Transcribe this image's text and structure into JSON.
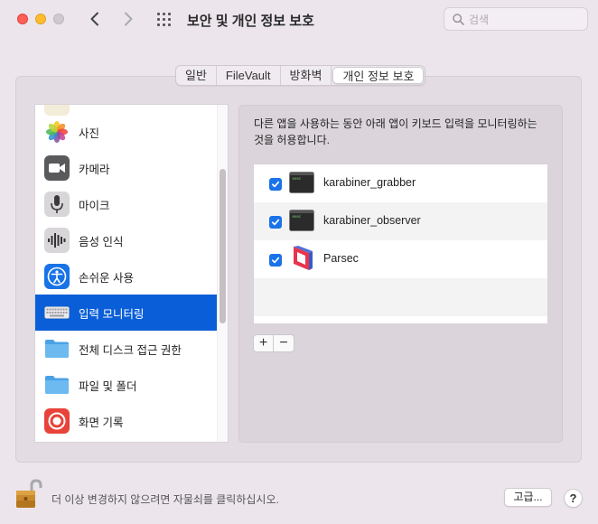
{
  "window": {
    "title": "보안 및 개인 정보 보호"
  },
  "search": {
    "placeholder": "검색"
  },
  "tabs": [
    {
      "label": "일반",
      "active": false
    },
    {
      "label": "FileVault",
      "active": false
    },
    {
      "label": "방화벽",
      "active": false
    },
    {
      "label": "개인 정보 보호",
      "active": true
    }
  ],
  "sidebar": {
    "items": [
      {
        "label": "사진",
        "icon": "photos-icon",
        "selected": false
      },
      {
        "label": "카메라",
        "icon": "camera-icon",
        "selected": false
      },
      {
        "label": "마이크",
        "icon": "microphone-icon",
        "selected": false
      },
      {
        "label": "음성 인식",
        "icon": "speech-recognition-icon",
        "selected": false
      },
      {
        "label": "손쉬운 사용",
        "icon": "accessibility-icon",
        "selected": false
      },
      {
        "label": "입력 모니터링",
        "icon": "keyboard-icon",
        "selected": true
      },
      {
        "label": "전체 디스크 접근 권한",
        "icon": "folder-icon",
        "selected": false
      },
      {
        "label": "파일 및 폴더",
        "icon": "folder-icon",
        "selected": false
      },
      {
        "label": "화면 기록",
        "icon": "screen-recording-icon",
        "selected": false
      }
    ]
  },
  "content": {
    "description_line1": "다른 앱을 사용하는 동안 아래 앱이 키보드 입력을 모니터링하는",
    "description_line2": "것을 허용합니다.",
    "apps": [
      {
        "name": "karabiner_grabber",
        "checked": true,
        "icon": "terminal-icon"
      },
      {
        "name": "karabiner_observer",
        "checked": true,
        "icon": "terminal-icon"
      },
      {
        "name": "Parsec",
        "checked": true,
        "icon": "parsec-icon"
      }
    ],
    "add_label": "+",
    "remove_label": "−"
  },
  "footer": {
    "lock_text": "더 이상 변경하지 않으려면 자물쇠를 클릭하십시오.",
    "advanced_label": "고급...",
    "help_label": "?"
  },
  "colors": {
    "accent": "#0a5fd8",
    "checkbox": "#1a73e8",
    "close": "#fe5f57",
    "minimize": "#febc2e"
  }
}
